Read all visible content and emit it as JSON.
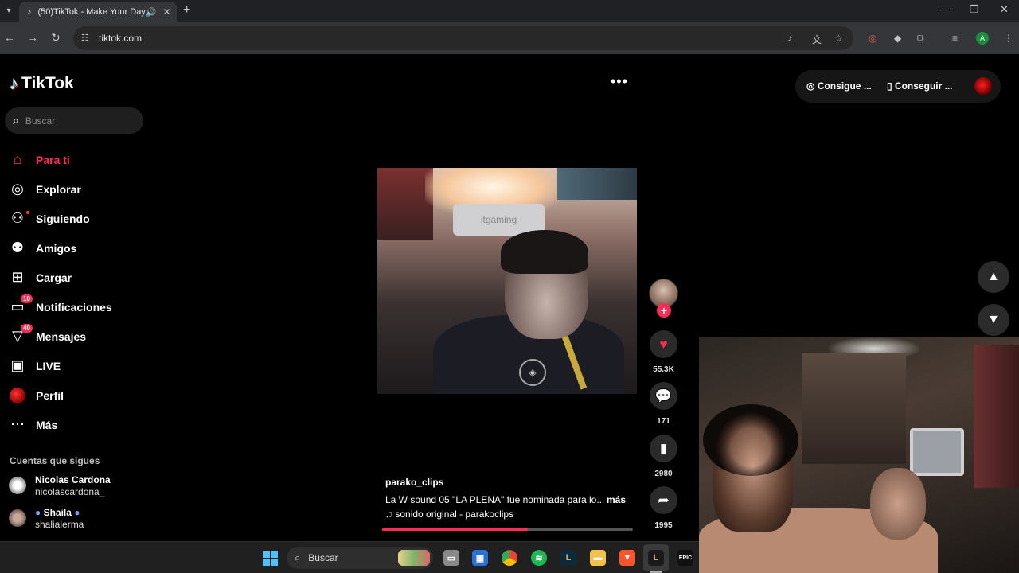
{
  "browser": {
    "tab_title": "(50)TikTok - Make Your Day",
    "tab_favicon": "tiktok-icon",
    "url": "tiktok.com"
  },
  "tiktok": {
    "logo_text": "TikTok",
    "search_placeholder": "Buscar",
    "nav": [
      {
        "label": "Para ti",
        "icon": "home-icon",
        "active": true
      },
      {
        "label": "Explorar",
        "icon": "compass-icon"
      },
      {
        "label": "Siguiendo",
        "icon": "following-icon"
      },
      {
        "label": "Amigos",
        "icon": "friends-icon"
      },
      {
        "label": "Cargar",
        "icon": "upload-icon"
      },
      {
        "label": "Notificaciones",
        "icon": "notifications-icon",
        "badge": "10"
      },
      {
        "label": "Mensajes",
        "icon": "messages-icon",
        "badge": "40"
      },
      {
        "label": "LIVE",
        "icon": "live-icon"
      },
      {
        "label": "Perfil",
        "icon": "profile-avatar"
      },
      {
        "label": "Más",
        "icon": "more-icon"
      }
    ],
    "following_title": "Cuentas que sigues",
    "following": [
      {
        "name": "Nicolas Cardona",
        "username": "nicolascardona_"
      },
      {
        "name": "Shaila",
        "username": "shalialerma"
      }
    ],
    "top_actions": {
      "coins": "Consigue ...",
      "app": "Conseguir ..."
    },
    "video": {
      "watermark": "itgaming",
      "likes": "55.3K",
      "comments": "171",
      "saves": "2980",
      "shares": "1995",
      "username": "parako_clips",
      "caption": "La W sound 05 \"LA PLENA\" fue nominada para lo...",
      "more": "más",
      "music": "sonido original - parakoclips",
      "progress": 0.58
    }
  },
  "taskbar": {
    "search_label": "Buscar"
  },
  "colors": {
    "accent": "#fe2c55",
    "background": "#000000",
    "chrome": "#35363a"
  }
}
